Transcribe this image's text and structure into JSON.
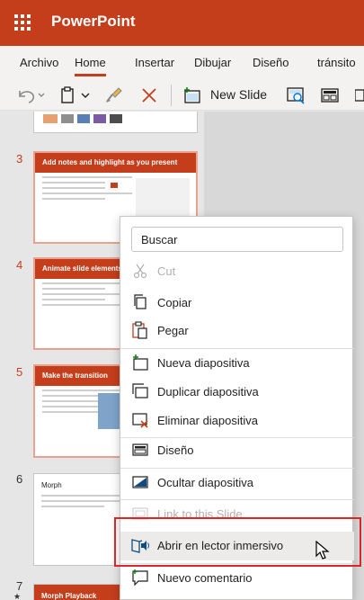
{
  "app": {
    "title": "PowerPoint"
  },
  "ribbon": {
    "tabs": [
      {
        "label": "Archivo"
      },
      {
        "label": "Home"
      },
      {
        "label": "Insertar"
      },
      {
        "label": "Dibujar"
      },
      {
        "label": "Diseño"
      },
      {
        "label": "tránsito"
      }
    ],
    "active_tab": "Home"
  },
  "toolbar": {
    "new_slide_label": "New Slide"
  },
  "slides": [
    {
      "number": "3",
      "title": "Add notes and highlight as you present"
    },
    {
      "number": "4",
      "title": "Animate slide elements"
    },
    {
      "number": "5",
      "title": "Make the transition"
    },
    {
      "number": "6",
      "title": "Morph"
    },
    {
      "number": "7",
      "title": "Morph Playback"
    }
  ],
  "context_menu": {
    "search_placeholder": "Buscar",
    "items": [
      {
        "label": "Cut",
        "icon": "scissors-icon",
        "disabled": true
      },
      {
        "label": "Copiar",
        "icon": "copy-icon",
        "disabled": false
      },
      {
        "label": "Pegar",
        "icon": "paste-icon",
        "disabled": false
      },
      {
        "label": "Nueva diapositiva",
        "icon": "new-slide-icon",
        "disabled": false
      },
      {
        "label": "Duplicar diapositiva",
        "icon": "duplicate-slide-icon",
        "disabled": false
      },
      {
        "label": "Eliminar diapositiva",
        "icon": "delete-slide-icon",
        "disabled": false
      },
      {
        "label": "Diseño",
        "icon": "layout-icon",
        "disabled": false
      },
      {
        "label": "Ocultar diapositiva",
        "icon": "hide-slide-icon",
        "disabled": false
      },
      {
        "label": "Link to this Slide",
        "icon": "link-icon",
        "disabled": true
      },
      {
        "label": "Abrir en lector inmersivo",
        "icon": "immersive-reader-icon",
        "disabled": false
      },
      {
        "label": "Nuevo comentario",
        "icon": "comment-icon",
        "disabled": false
      }
    ]
  },
  "colors": {
    "brand": "#c43e1c",
    "highlight_border": "#e0242b"
  }
}
